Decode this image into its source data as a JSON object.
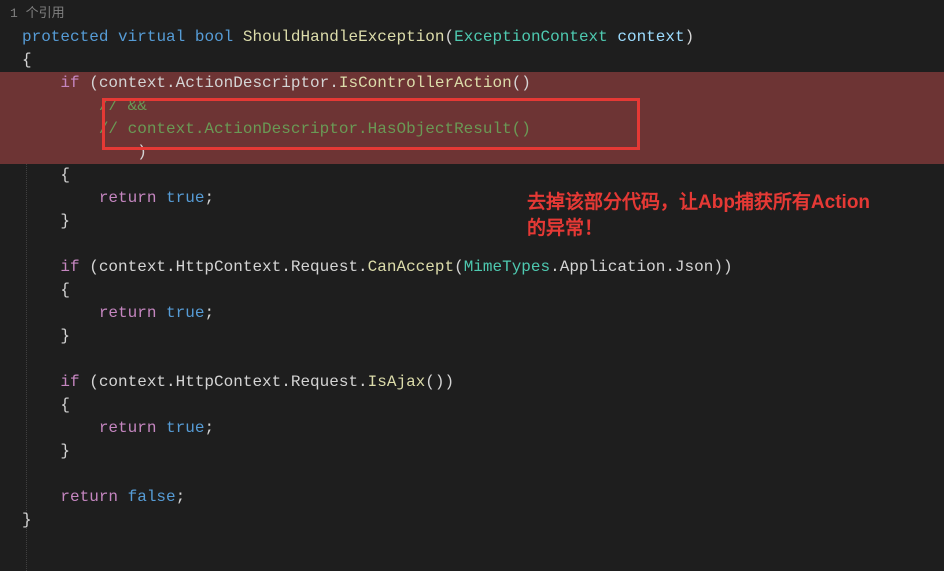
{
  "reference": "1 个引用",
  "code": {
    "line1": {
      "protected": "protected",
      "virtual": "virtual",
      "bool": "bool",
      "method": "ShouldHandleException",
      "paramType": "ExceptionContext",
      "paramName": "context"
    },
    "line2": "{",
    "line3": {
      "if": "if",
      "text1": " (context.ActionDescriptor.",
      "method1": "IsControllerAction",
      "text2": "()"
    },
    "line4": "// &&",
    "line5": "// context.ActionDescriptor.HasObjectResult()",
    "line6": ")",
    "line7": "{",
    "line8_return": "return",
    "line8_true": "true",
    "line8_semi": ";",
    "line9": "}",
    "line11": {
      "if": "if",
      "text1": " (context.HttpContext.Request.",
      "method1": "CanAccept",
      "text2": "(",
      "type1": "MimeTypes",
      "text3": ".Application.Json))"
    },
    "line12": "{",
    "line13_return": "return",
    "line13_true": "true",
    "line13_semi": ";",
    "line14": "}",
    "line16": {
      "if": "if",
      "text1": " (context.HttpContext.Request.",
      "method1": "IsAjax",
      "text2": "())"
    },
    "line17": "{",
    "line18_return": "return",
    "line18_true": "true",
    "line18_semi": ";",
    "line19": "}",
    "line21_return": "return",
    "line21_false": "false",
    "line21_semi": ";",
    "line22": "}"
  },
  "annotation": {
    "line1": "去掉该部分代码，让Abp捕获所有Action",
    "line2": "的异常！"
  }
}
